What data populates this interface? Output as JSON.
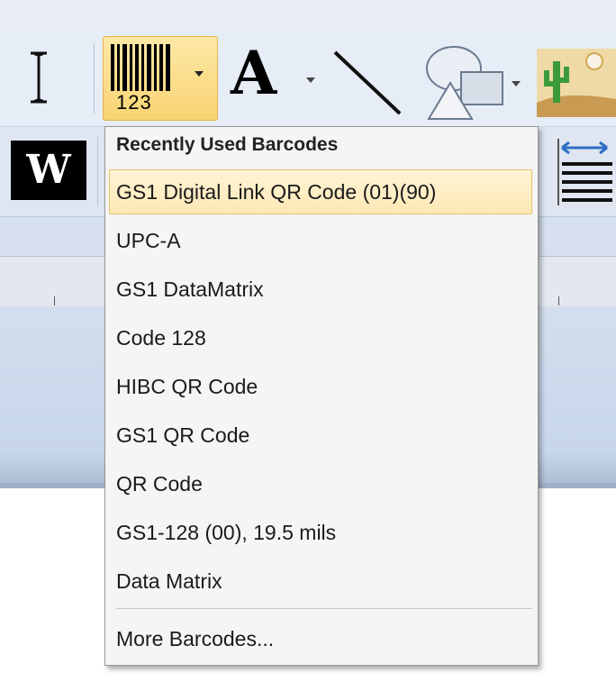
{
  "toolbar": {
    "barcode_button_caption": "123",
    "text_tool_glyph": "A",
    "word_art_glyph": "W",
    "icons": [
      "text-cursor-icon",
      "barcode-icon",
      "text-icon",
      "line-icon",
      "shapes-icon",
      "picture-icon",
      "word-art-icon",
      "align-icon"
    ]
  },
  "barcode_menu": {
    "header": "Recently Used Barcodes",
    "items": [
      {
        "label": "GS1 Digital Link QR Code (01)(90)",
        "highlighted": true
      },
      {
        "label": "UPC-A"
      },
      {
        "label": "GS1 DataMatrix"
      },
      {
        "label": "Code 128"
      },
      {
        "label": "HIBC QR Code"
      },
      {
        "label": "GS1 QR Code"
      },
      {
        "label": "QR Code"
      },
      {
        "label": "GS1-128 (00), 19.5 mils"
      },
      {
        "label": "Data Matrix"
      }
    ],
    "more": "More Barcodes..."
  },
  "colors": {
    "highlight_bg": "#fde8b5",
    "highlight_border": "#e5c365",
    "button_active": "#f8d373"
  }
}
